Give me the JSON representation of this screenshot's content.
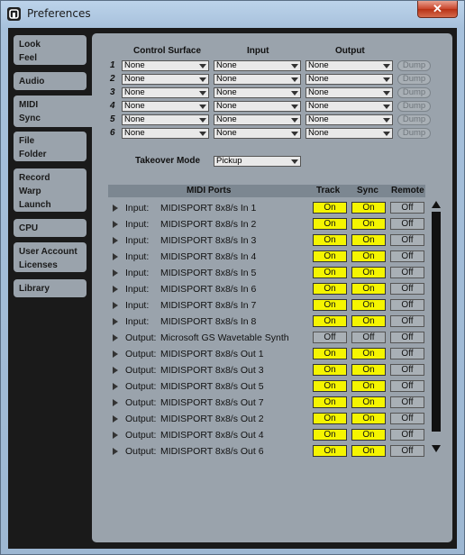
{
  "window": {
    "title": "Preferences",
    "close_label": "✕"
  },
  "sidebar": {
    "tabs": [
      {
        "lines": [
          "Look",
          "Feel"
        ]
      },
      {
        "lines": [
          "Audio"
        ]
      },
      {
        "lines": [
          "MIDI",
          "Sync"
        ]
      },
      {
        "lines": [
          "File",
          "Folder"
        ]
      },
      {
        "lines": [
          "Record",
          "Warp",
          "Launch"
        ]
      },
      {
        "lines": [
          "CPU"
        ]
      },
      {
        "lines": [
          "User Account",
          "Licenses"
        ]
      },
      {
        "lines": [
          "Library"
        ]
      }
    ],
    "active": "MIDI Sync"
  },
  "control_surfaces": {
    "headers": {
      "control_surface": "Control Surface",
      "input": "Input",
      "output": "Output"
    },
    "rows": [
      {
        "num": "1",
        "surface": "None",
        "input": "None",
        "output": "None",
        "dump": "Dump"
      },
      {
        "num": "2",
        "surface": "None",
        "input": "None",
        "output": "None",
        "dump": "Dump"
      },
      {
        "num": "3",
        "surface": "None",
        "input": "None",
        "output": "None",
        "dump": "Dump"
      },
      {
        "num": "4",
        "surface": "None",
        "input": "None",
        "output": "None",
        "dump": "Dump"
      },
      {
        "num": "5",
        "surface": "None",
        "input": "None",
        "output": "None",
        "dump": "Dump"
      },
      {
        "num": "6",
        "surface": "None",
        "input": "None",
        "output": "None",
        "dump": "Dump"
      }
    ]
  },
  "takeover": {
    "label": "Takeover Mode",
    "value": "Pickup"
  },
  "ports": {
    "headers": {
      "ports": "MIDI Ports",
      "track": "Track",
      "sync": "Sync",
      "remote": "Remote"
    },
    "rows": [
      {
        "type": "Input:",
        "name": "MIDISPORT 8x8/s In 1",
        "track": "On",
        "sync": "On",
        "remote": "Off"
      },
      {
        "type": "Input:",
        "name": "MIDISPORT 8x8/s In 2",
        "track": "On",
        "sync": "On",
        "remote": "Off"
      },
      {
        "type": "Input:",
        "name": "MIDISPORT 8x8/s In 3",
        "track": "On",
        "sync": "On",
        "remote": "Off"
      },
      {
        "type": "Input:",
        "name": "MIDISPORT 8x8/s In 4",
        "track": "On",
        "sync": "On",
        "remote": "Off"
      },
      {
        "type": "Input:",
        "name": "MIDISPORT 8x8/s In 5",
        "track": "On",
        "sync": "On",
        "remote": "Off"
      },
      {
        "type": "Input:",
        "name": "MIDISPORT 8x8/s In 6",
        "track": "On",
        "sync": "On",
        "remote": "Off"
      },
      {
        "type": "Input:",
        "name": "MIDISPORT 8x8/s In 7",
        "track": "On",
        "sync": "On",
        "remote": "Off"
      },
      {
        "type": "Input:",
        "name": "MIDISPORT 8x8/s In 8",
        "track": "On",
        "sync": "On",
        "remote": "Off"
      },
      {
        "type": "Output:",
        "name": "Microsoft GS Wavetable Synth",
        "track": "Off",
        "sync": "Off",
        "remote": "Off"
      },
      {
        "type": "Output:",
        "name": "MIDISPORT 8x8/s Out 1",
        "track": "On",
        "sync": "On",
        "remote": "Off"
      },
      {
        "type": "Output:",
        "name": "MIDISPORT 8x8/s Out 3",
        "track": "On",
        "sync": "On",
        "remote": "Off"
      },
      {
        "type": "Output:",
        "name": "MIDISPORT 8x8/s Out 5",
        "track": "On",
        "sync": "On",
        "remote": "Off"
      },
      {
        "type": "Output:",
        "name": "MIDISPORT 8x8/s Out 7",
        "track": "On",
        "sync": "On",
        "remote": "Off"
      },
      {
        "type": "Output:",
        "name": "MIDISPORT 8x8/s Out 2",
        "track": "On",
        "sync": "On",
        "remote": "Off"
      },
      {
        "type": "Output:",
        "name": "MIDISPORT 8x8/s Out 4",
        "track": "On",
        "sync": "On",
        "remote": "Off"
      },
      {
        "type": "Output:",
        "name": "MIDISPORT 8x8/s Out 6",
        "track": "On",
        "sync": "On",
        "remote": "Off"
      }
    ]
  },
  "colors": {
    "on": "#f5f500",
    "panel": "#9aa3ac",
    "background": "#1a1a1a"
  }
}
